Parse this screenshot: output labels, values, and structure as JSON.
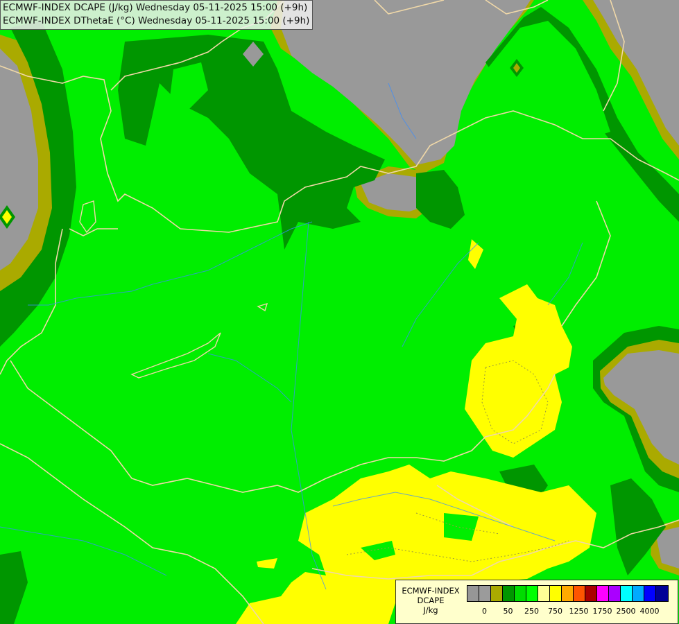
{
  "title": {
    "line1": "ECMWF-INDEX DCAPE (J/kg) Wednesday 05-11-2025 15:00 (+9h)",
    "line2": "ECMWF-INDEX DThetaE (°C) Wednesday 05-11-2025 15:00 (+9h)"
  },
  "legend": {
    "line1": "ECMWF-INDEX",
    "line2": "DCAPE",
    "line3": "J/kg",
    "swatch_colors": [
      "#969696",
      "#9b9b9b",
      "#aaaa00",
      "#009600",
      "#00dc00",
      "#00ff00",
      "#ffff96",
      "#ffff00",
      "#ffaa00",
      "#ff5500",
      "#aa0000",
      "#ff00ff",
      "#aa00ff",
      "#00ffff",
      "#00aaff",
      "#0000ff",
      "#000096"
    ],
    "tick_labels": [
      {
        "label": "0",
        "slot": 1
      },
      {
        "label": "50",
        "slot": 3
      },
      {
        "label": "250",
        "slot": 5
      },
      {
        "label": "750",
        "slot": 7
      },
      {
        "label": "1250",
        "slot": 9
      },
      {
        "label": "1750",
        "slot": 11
      },
      {
        "label": "2500",
        "slot": 13
      },
      {
        "label": "4000",
        "slot": 15
      }
    ]
  },
  "colors": {
    "gray": "#999999",
    "olive": "#aaaa00",
    "dark_green": "#009600",
    "bright_green": "#00ee00",
    "yellow": "#ffff00",
    "border": "#f0d8a8",
    "river": "#3a8cff"
  }
}
